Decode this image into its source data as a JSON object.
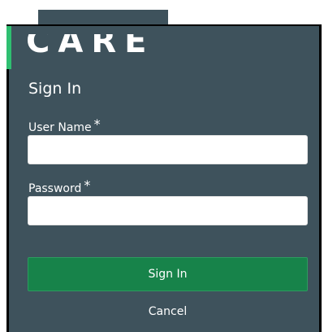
{
  "logo": {
    "text": "CAREER"
  },
  "form": {
    "heading": "Sign In",
    "username_label": "User Name",
    "username_value": "",
    "password_label": "Password",
    "password_value": "",
    "required_marker": "*",
    "submit_label": "Sign In",
    "cancel_label": "Cancel"
  },
  "colors": {
    "panel_bg": "#3e525c",
    "accent": "#2fbf71",
    "primary_button": "#17834a"
  }
}
